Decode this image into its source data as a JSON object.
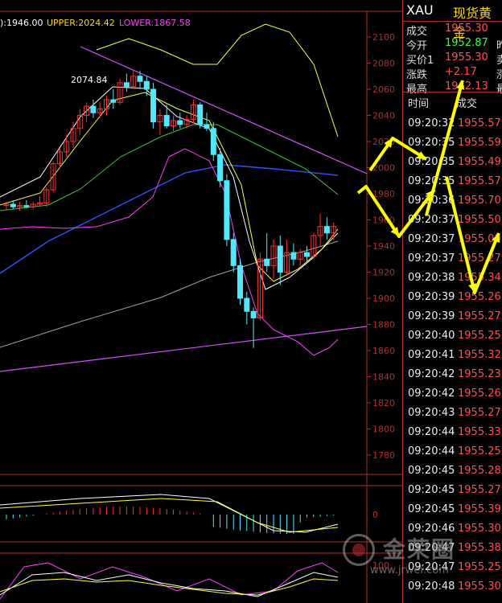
{
  "header": {
    "ma_label": "):1946.00",
    "upper_label": "UPPER:2024.42",
    "lower_label": "LOWER:1867.58"
  },
  "colors": {
    "up": "#ff3030",
    "down": "#50e8ff",
    "ma5": "#ffffff",
    "ma10": "#ffff40",
    "ma20": "#40c040",
    "ma60": "#3050ff",
    "ma_long": "#a0a0a0",
    "boll": "#ff40ff",
    "trend": "#d050ff",
    "arrow": "#ffff00",
    "axis": "#b03030"
  },
  "chart_data": {
    "type": "candlestick",
    "y_ticks": [
      "2100",
      "2080",
      "2060",
      "2040",
      "2020",
      "2000",
      "1980",
      "1960",
      "1940",
      "1920",
      "1900",
      "1880",
      "1860",
      "1840",
      "1820",
      "1800",
      "1780"
    ],
    "ylim": [
      1765,
      2105
    ],
    "annotations": [
      "2074.84"
    ],
    "candles": [
      {
        "o": 1971,
        "h": 1974,
        "l": 1968,
        "c": 1972
      },
      {
        "o": 1972,
        "h": 1975,
        "l": 1968,
        "c": 1970
      },
      {
        "o": 1970,
        "h": 1974,
        "l": 1967,
        "c": 1971
      },
      {
        "o": 1971,
        "h": 1975,
        "l": 1969,
        "c": 1970
      },
      {
        "o": 1970,
        "h": 1974,
        "l": 1968,
        "c": 1972
      },
      {
        "o": 1972,
        "h": 1978,
        "l": 1970,
        "c": 1973
      },
      {
        "o": 1973,
        "h": 1985,
        "l": 1970,
        "c": 1983
      },
      {
        "o": 1983,
        "h": 2005,
        "l": 1981,
        "c": 2003
      },
      {
        "o": 2003,
        "h": 2015,
        "l": 2000,
        "c": 2012
      },
      {
        "o": 2012,
        "h": 2025,
        "l": 2008,
        "c": 2020
      },
      {
        "o": 2020,
        "h": 2035,
        "l": 2015,
        "c": 2030
      },
      {
        "o": 2030,
        "h": 2045,
        "l": 2025,
        "c": 2040
      },
      {
        "o": 2040,
        "h": 2050,
        "l": 2035,
        "c": 2047
      },
      {
        "o": 2047,
        "h": 2052,
        "l": 2038,
        "c": 2042
      },
      {
        "o": 2042,
        "h": 2050,
        "l": 2038,
        "c": 2045
      },
      {
        "o": 2045,
        "h": 2055,
        "l": 2040,
        "c": 2052
      },
      {
        "o": 2052,
        "h": 2060,
        "l": 2045,
        "c": 2050
      },
      {
        "o": 2050,
        "h": 2068,
        "l": 2048,
        "c": 2065
      },
      {
        "o": 2065,
        "h": 2072,
        "l": 2058,
        "c": 2062
      },
      {
        "o": 2062,
        "h": 2075,
        "l": 2060,
        "c": 2070
      },
      {
        "o": 2070,
        "h": 2074,
        "l": 2060,
        "c": 2066
      },
      {
        "o": 2066,
        "h": 2070,
        "l": 2055,
        "c": 2060
      },
      {
        "o": 2060,
        "h": 2065,
        "l": 2030,
        "c": 2035
      },
      {
        "o": 2035,
        "h": 2045,
        "l": 2025,
        "c": 2040
      },
      {
        "o": 2040,
        "h": 2048,
        "l": 2030,
        "c": 2032
      },
      {
        "o": 2032,
        "h": 2040,
        "l": 2028,
        "c": 2036
      },
      {
        "o": 2036,
        "h": 2042,
        "l": 2030,
        "c": 2033
      },
      {
        "o": 2033,
        "h": 2040,
        "l": 2030,
        "c": 2037
      },
      {
        "o": 2037,
        "h": 2052,
        "l": 2034,
        "c": 2048
      },
      {
        "o": 2048,
        "h": 2050,
        "l": 2030,
        "c": 2033
      },
      {
        "o": 2033,
        "h": 2042,
        "l": 2028,
        "c": 2030
      },
      {
        "o": 2030,
        "h": 2035,
        "l": 2005,
        "c": 2010
      },
      {
        "o": 2010,
        "h": 2015,
        "l": 1985,
        "c": 1990
      },
      {
        "o": 1990,
        "h": 1995,
        "l": 1940,
        "c": 1945
      },
      {
        "o": 1945,
        "h": 1950,
        "l": 1920,
        "c": 1925
      },
      {
        "o": 1925,
        "h": 1930,
        "l": 1895,
        "c": 1900
      },
      {
        "o": 1900,
        "h": 1905,
        "l": 1880,
        "c": 1890
      },
      {
        "o": 1890,
        "h": 1893,
        "l": 1862,
        "c": 1885
      },
      {
        "o": 1885,
        "h": 1935,
        "l": 1883,
        "c": 1930
      },
      {
        "o": 1930,
        "h": 1950,
        "l": 1920,
        "c": 1925
      },
      {
        "o": 1925,
        "h": 1945,
        "l": 1915,
        "c": 1940
      },
      {
        "o": 1940,
        "h": 1948,
        "l": 1910,
        "c": 1920
      },
      {
        "o": 1920,
        "h": 1945,
        "l": 1918,
        "c": 1935
      },
      {
        "o": 1935,
        "h": 1942,
        "l": 1925,
        "c": 1930
      },
      {
        "o": 1930,
        "h": 1938,
        "l": 1925,
        "c": 1935
      },
      {
        "o": 1935,
        "h": 1940,
        "l": 1928,
        "c": 1932
      },
      {
        "o": 1932,
        "h": 1950,
        "l": 1930,
        "c": 1948
      },
      {
        "o": 1948,
        "h": 1965,
        "l": 1940,
        "c": 1955
      },
      {
        "o": 1955,
        "h": 1962,
        "l": 1945,
        "c": 1950
      },
      {
        "o": 1950,
        "h": 1958,
        "l": 1945,
        "c": 1955
      }
    ],
    "macd_label": "0",
    "kdj_label": "100"
  },
  "quote": {
    "symbol": "XAU",
    "name": "现货黄金",
    "rows": [
      {
        "label": "成交",
        "value": "1955.30",
        "color": "#ff5050",
        "extra": ""
      },
      {
        "label": "今开",
        "value": "1952.87",
        "color": "#40ff40",
        "extra": "昨"
      },
      {
        "label": "买价1",
        "value": "1955.30",
        "color": "#ff5050",
        "extra": "卖"
      },
      {
        "label": "涨跌",
        "value": "+2.17",
        "color": "#ff5050",
        "extra": "涨"
      },
      {
        "label": "最高",
        "value": "1962.13",
        "color": "#ff5050",
        "extra": "最"
      }
    ]
  },
  "ticks": {
    "header_time": "时间",
    "header_price": "成交",
    "rows": [
      {
        "time": "09:20:32",
        "price": "1955.57"
      },
      {
        "time": "09:20:35",
        "price": "1955.59"
      },
      {
        "time": "09:20:35",
        "price": "1955.49"
      },
      {
        "time": "09:20:35",
        "price": "1955.57"
      },
      {
        "time": "09:20:36",
        "price": "1955.70"
      },
      {
        "time": "09:20:37",
        "price": "1955.50"
      },
      {
        "time": "09:20:37",
        "price": "1955.09"
      },
      {
        "time": "09:20:37",
        "price": "1955.27"
      },
      {
        "time": "09:20:38",
        "price": "1955.34"
      },
      {
        "time": "09:20:39",
        "price": "1955.26"
      },
      {
        "time": "09:20:39",
        "price": "1955.27"
      },
      {
        "time": "09:20:40",
        "price": "1955.25"
      },
      {
        "time": "09:20:41",
        "price": "1955.32"
      },
      {
        "time": "09:20:42",
        "price": "1955.23"
      },
      {
        "time": "09:20:42",
        "price": "1955.26"
      },
      {
        "time": "09:20:43",
        "price": "1955.27"
      },
      {
        "time": "09:20:44",
        "price": "1955.33"
      },
      {
        "time": "09:20:44",
        "price": "1955.25"
      },
      {
        "time": "09:20:45",
        "price": "1955.28"
      },
      {
        "time": "09:20:45",
        "price": "1955.27"
      },
      {
        "time": "09:20:45",
        "price": "1955.39"
      },
      {
        "time": "09:20:46",
        "price": "1955.30"
      },
      {
        "time": "09:20:47",
        "price": "1955.38"
      },
      {
        "time": "09:20:47",
        "price": "1955.25"
      },
      {
        "time": "09:20:48",
        "price": "1955.30"
      }
    ]
  },
  "watermark": {
    "name": "金荣圈",
    "url": "www.jrwei.com"
  }
}
